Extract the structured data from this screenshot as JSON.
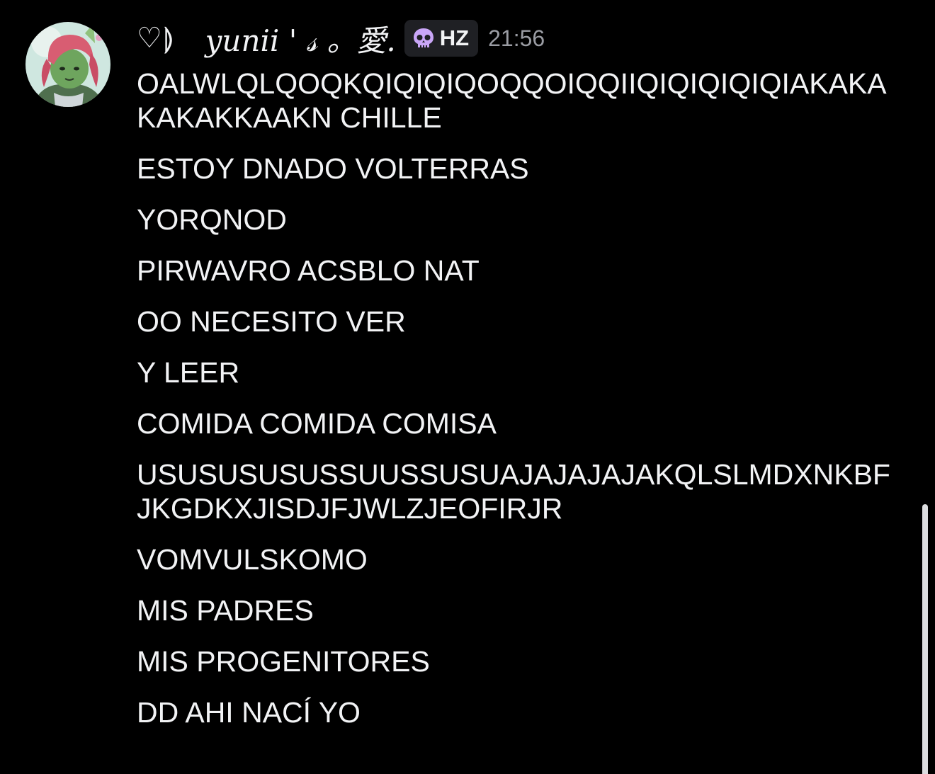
{
  "message": {
    "author": {
      "decoration": "♡⟭",
      "name": "yunii ' 𝓈  。愛.",
      "avatar_icon": "avatar-icon"
    },
    "tag": {
      "icon": "skull-icon",
      "text": "HZ",
      "icon_color": "#c9a6f7"
    },
    "timestamp": "21:56",
    "lines": [
      "OALWLQLQOQKQIQIQIQOQQOIQQIIQIQIQIQIQIAKAKAKAKAKKAAKN CHILLE",
      "ESTOY DNADO VOLTERRAS",
      "YORQNOD",
      "PIRWAVRO ACSBLO NAT",
      "OO NECESITO VER",
      "Y LEER",
      "COMIDA COMIDA COMISA",
      "USUSUSUSUSSUUSSUSUAJAJAJAJAKQLSLMDXNKBFJKGDKXJISDJFJWLZJEOFIRJR",
      "VOMVULSKOMO",
      "MIS PADRES",
      "MIS PROGENITORES",
      "DD AHI NACÍ YO"
    ]
  },
  "colors": {
    "background": "#000000",
    "text": "#f2f3f5",
    "timestamp": "#9a9ca3",
    "badge_bg": "#1f2024"
  }
}
